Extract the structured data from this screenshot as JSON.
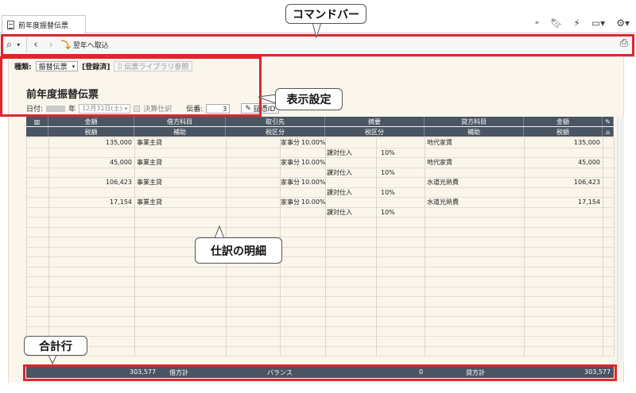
{
  "window": {
    "tab_title": "前年度振替伝票",
    "more_glyph": "»"
  },
  "toolbar": {
    "import_label": "翌年へ取込"
  },
  "form": {
    "type_label": "種類:",
    "type_value": "振替伝票",
    "status": "[登録済]",
    "library_button": "伝票ライブラリ参照",
    "title": "前年度振替伝票",
    "date_label": "日付:",
    "year_suffix": "年",
    "date_value": "12月31日(土)",
    "closing_label": "決算仕訳",
    "voucher_no_label": "伝番:",
    "voucher_no": "3",
    "evidence_button": "証憑ID"
  },
  "table": {
    "header_row1": [
      "金額",
      "借方科目",
      "取引先",
      "摘要",
      "貸方科目",
      "金額"
    ],
    "header_row2": [
      "税額",
      "補助",
      "税区分",
      "税区分",
      "補助",
      "税額"
    ],
    "rows": [
      {
        "amount": "135,000",
        "debit": "事業主貸",
        "rate_label": "家事分",
        "rate": "10.00%",
        "sub_tax": "課対仕入",
        "sub_rate": "10%",
        "credit": "地代家賃",
        "credit_amount": "135,000"
      },
      {
        "amount": "45,000",
        "debit": "事業主貸",
        "rate_label": "家事分",
        "rate": "10.00%",
        "sub_tax": "課対仕入",
        "sub_rate": "10%",
        "credit": "地代家賃",
        "credit_amount": "45,000"
      },
      {
        "amount": "106,423",
        "debit": "事業主貸",
        "rate_label": "家事分",
        "rate": "10.00%",
        "sub_tax": "課対仕入",
        "sub_rate": "10%",
        "credit": "水道光熱費",
        "credit_amount": "106,423"
      },
      {
        "amount": "17,154",
        "debit": "事業主貸",
        "rate_label": "家事分",
        "rate": "10.00%",
        "sub_tax": "課対仕入",
        "sub_rate": "10%",
        "credit": "水道光熱費",
        "credit_amount": "17,154"
      }
    ]
  },
  "totals": {
    "debit_total": "303,577",
    "debit_label": "借方計",
    "balance_label": "バランス",
    "balance": "0",
    "credit_label": "貸方計",
    "credit_total": "303,577"
  },
  "callouts": {
    "command_bar": "コマンドバー",
    "display_settings": "表示設定",
    "journal_details": "仕訳の明細",
    "totals_row": "合計行"
  },
  "colors": {
    "highlight": "#e0262b",
    "header_bg": "#4a5563",
    "form_bg": "#fbf6ec"
  }
}
